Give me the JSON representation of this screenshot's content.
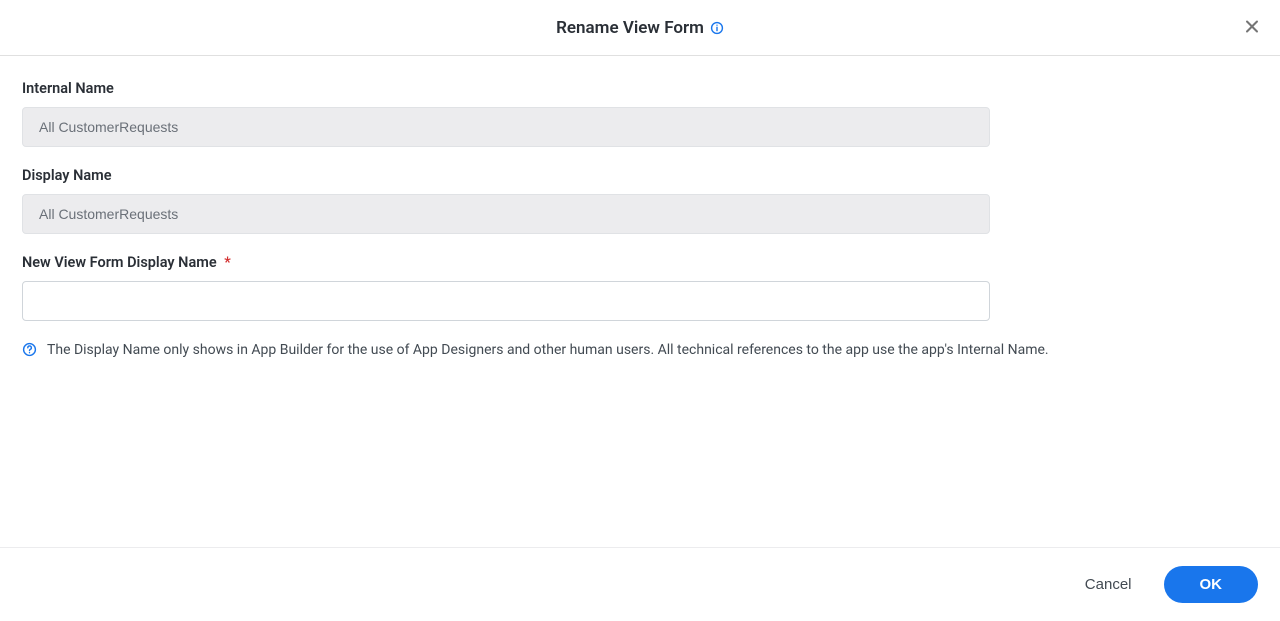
{
  "header": {
    "title": "Rename View Form"
  },
  "form": {
    "internal_name": {
      "label": "Internal Name",
      "value": "All CustomerRequests"
    },
    "display_name": {
      "label": "Display Name",
      "value": "All CustomerRequests"
    },
    "new_display_name": {
      "label": "New View Form Display Name",
      "required_mark": "*",
      "value": ""
    },
    "info_text": "The Display Name only shows in App Builder for the use of App Designers and other human users. All technical references to the app use the app's Internal Name."
  },
  "footer": {
    "cancel_label": "Cancel",
    "ok_label": "OK"
  }
}
